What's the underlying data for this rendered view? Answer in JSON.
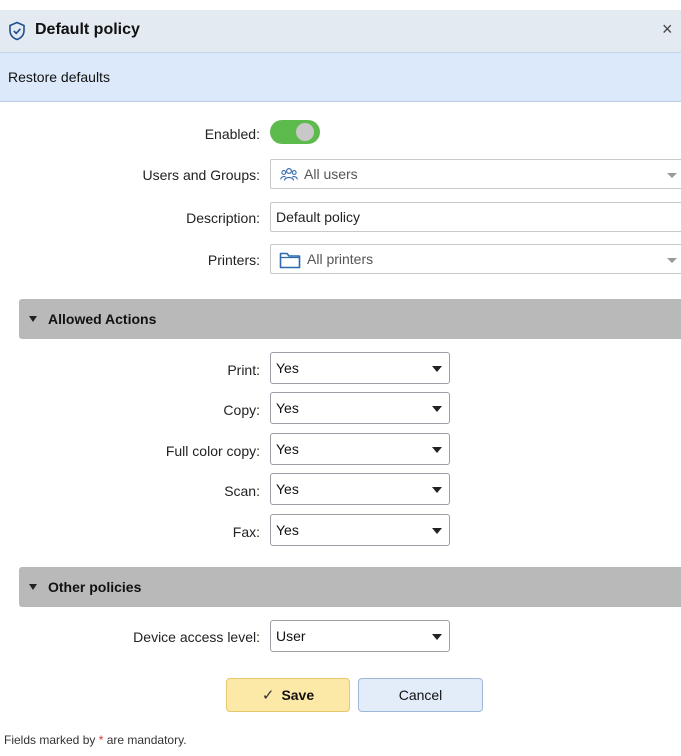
{
  "dialog": {
    "title": "Default policy",
    "close_glyph": "×",
    "icon": "shield-check-icon"
  },
  "toolbar": {
    "restore_label": "Restore defaults"
  },
  "general": {
    "enabled_label": "Enabled:",
    "enabled": true,
    "users_label": "Users and Groups:",
    "users_value": "All users",
    "users_icon": "users-icon",
    "description_label": "Description:",
    "description_value": "Default policy",
    "printers_label": "Printers:",
    "printers_value": "All printers",
    "printers_icon": "folder-icon"
  },
  "allowed_actions": {
    "title": "Allowed Actions",
    "rows": [
      {
        "label": "Print:",
        "value": "Yes"
      },
      {
        "label": "Copy:",
        "value": "Yes"
      },
      {
        "label": "Full color copy:",
        "value": "Yes"
      },
      {
        "label": "Scan:",
        "value": "Yes"
      },
      {
        "label": "Fax:",
        "value": "Yes"
      }
    ]
  },
  "other_policies": {
    "title": "Other policies",
    "access_label": "Device access level:",
    "access_value": "User"
  },
  "buttons": {
    "save_label": "Save",
    "cancel_label": "Cancel"
  },
  "footer": {
    "text_before": "Fields marked by ",
    "star": "*",
    "text_after": " are mandatory."
  },
  "colors": {
    "toggle_on": "#5dbb4d",
    "save_bg": "#fde9a7",
    "cancel_bg": "#e2edf9",
    "section_bg": "#b9b9b9",
    "toolbar_bg": "#dbe9fa",
    "title_bg": "#e4eaf2"
  }
}
